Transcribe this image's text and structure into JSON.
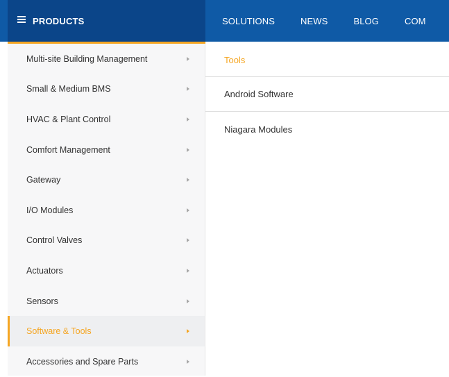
{
  "header": {
    "products_label": "PRODUCTS",
    "nav_links": [
      "SOLUTIONS",
      "NEWS",
      "BLOG",
      "COM"
    ]
  },
  "sidebar": {
    "items": [
      {
        "label": "Multi-site Building Management"
      },
      {
        "label": "Small & Medium BMS"
      },
      {
        "label": "HVAC & Plant Control"
      },
      {
        "label": "Comfort Management"
      },
      {
        "label": "Gateway"
      },
      {
        "label": "I/O Modules"
      },
      {
        "label": "Control Valves"
      },
      {
        "label": "Actuators"
      },
      {
        "label": "Sensors"
      },
      {
        "label": "Software & Tools",
        "active": true
      },
      {
        "label": "Accessories and Spare Parts"
      }
    ]
  },
  "submenu": {
    "items": [
      {
        "label": "Tools",
        "active": true
      },
      {
        "label": "Android Software"
      },
      {
        "label": "Niagara Modules"
      }
    ]
  },
  "colors": {
    "nav_blue": "#0f5aa6",
    "products_blue": "#0b4589",
    "accent_orange": "#f5a623",
    "menu_bg": "#f7f7f8",
    "text": "#333333"
  }
}
